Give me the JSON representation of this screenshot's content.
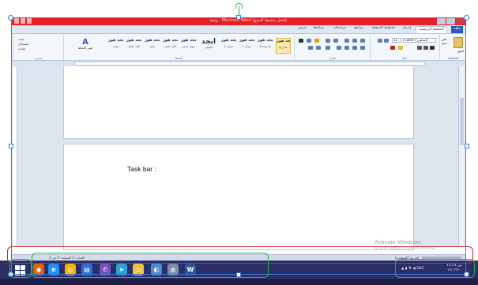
{
  "window": {
    "title": "وثيقة - Microsoft Word (فشل تنشيط المنتج)"
  },
  "ribbon": {
    "tabs": [
      {
        "label": "ملف",
        "type": "file"
      },
      {
        "label": "الصفحة الرئيسية",
        "type": "active"
      },
      {
        "label": "إدراج"
      },
      {
        "label": "تخطيط الصفحة"
      },
      {
        "label": "مراجع"
      },
      {
        "label": "مراسلات"
      },
      {
        "label": "مراجعة"
      },
      {
        "label": "عرض"
      }
    ],
    "clipboard": {
      "paste_label": "لصق",
      "cut": "قص",
      "copy": "نسخ",
      "format_painter": "نسخ التنسيق",
      "group": "الحافظة"
    },
    "font": {
      "name": "Calibri (أساسي)",
      "size": "11",
      "group": "خط"
    },
    "paragraph": {
      "group": "فقرة"
    },
    "styles": {
      "group": "أنماط",
      "items": [
        {
          "preview": "أبجد هوز",
          "name": "¶ عادي",
          "selected": true
        },
        {
          "preview": "أبجد هوز",
          "name": "¶ بلا تباعد"
        },
        {
          "preview": "أبجد هوز",
          "name": "عنوان 1"
        },
        {
          "preview": "أبجد هوز",
          "name": "عنوان 2"
        },
        {
          "preview": "أبجد",
          "name": "العنوان",
          "big": true
        },
        {
          "preview": "أبجد هوز",
          "name": "عنوان فرعي"
        },
        {
          "preview": "أبجد هوز",
          "name": "تأكيد خفيف"
        },
        {
          "preview": "أبجد هوز",
          "name": "توكيد"
        },
        {
          "preview": "أبجد هوز",
          "name": "تأكيد مكثف"
        },
        {
          "preview": "أبجد هوز",
          "name": "مشدد"
        }
      ],
      "change_styles": "تغيير الأنماط"
    },
    "editing": {
      "find": "بحث",
      "replace": "استبدال",
      "select": "تحديد",
      "group": "تحرير"
    }
  },
  "document": {
    "page2_text": "Task bar :"
  },
  "watermark": {
    "line1": "Activate Windows",
    "line2": "Go to PC settings to activate Windows."
  },
  "statusbar": {
    "left": "كلمات: 3  الصفحة: 2 من 2",
    "right": "العربية (السعودية)"
  },
  "taskbar": {
    "apps": [
      {
        "name": "firefox",
        "glyph": "◉",
        "color": "#e66000"
      },
      {
        "name": "internet-explorer",
        "glyph": "e",
        "color": "#1e90ff"
      },
      {
        "name": "chrome",
        "glyph": "◎",
        "color": "#f4b400"
      },
      {
        "name": "store",
        "glyph": "▤",
        "color": "#2a6fd8"
      },
      {
        "name": "viber",
        "glyph": "✆",
        "color": "#7a4bc2"
      },
      {
        "name": "telegram",
        "glyph": "➤",
        "color": "#2aa3dd"
      },
      {
        "name": "file-explorer",
        "glyph": "▭",
        "color": "#f0c040"
      },
      {
        "name": "media-player",
        "glyph": "◐",
        "color": "#4a8fd0"
      },
      {
        "name": "browser",
        "glyph": "◍",
        "color": "#7d8fa8"
      },
      {
        "name": "word",
        "glyph": "W",
        "color": "#2b579a"
      }
    ],
    "language": "ENG",
    "time": "11:51 ص",
    "date": "١٤/٠٣/٢٠"
  },
  "annotation": {
    "red_color": "#d2232a",
    "green_color": "#2bb04a"
  }
}
